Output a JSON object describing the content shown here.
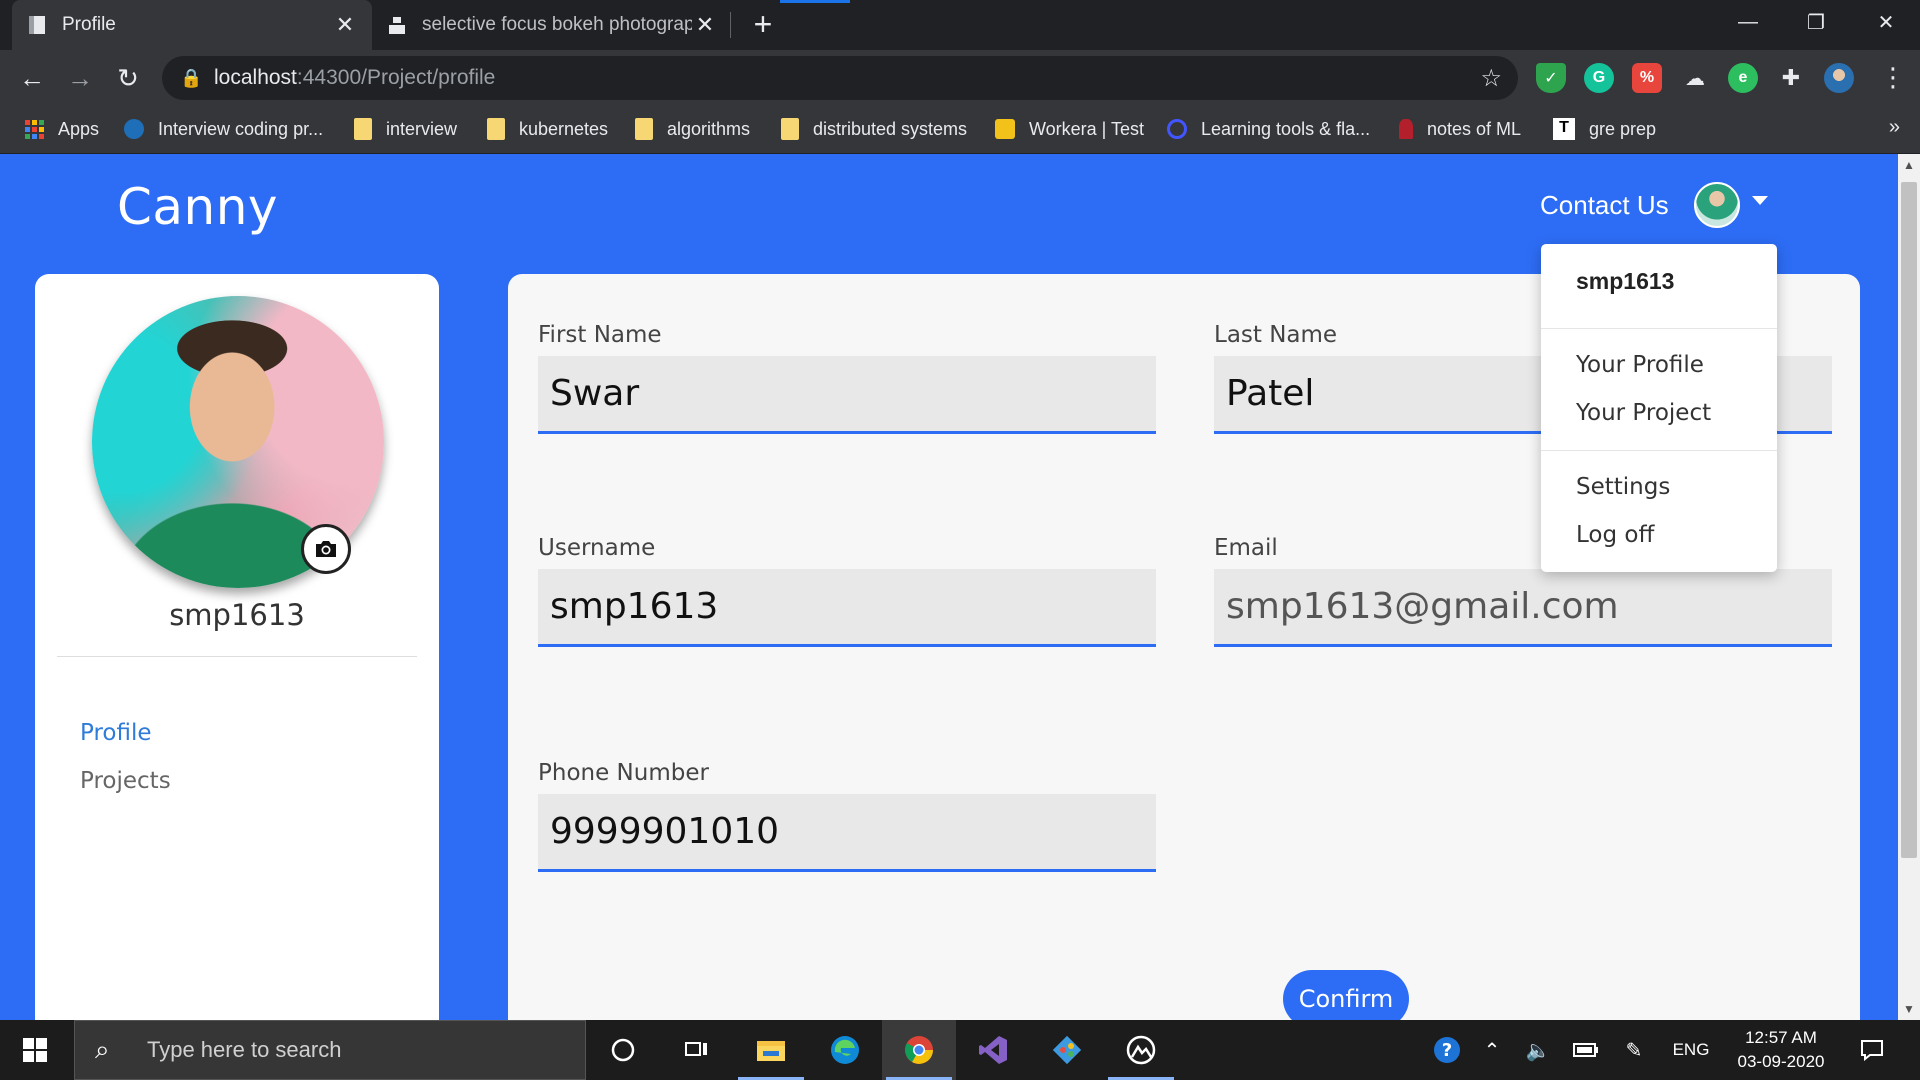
{
  "browser": {
    "tabs": [
      {
        "title": "Profile",
        "active": true
      },
      {
        "title": "selective focus bokeh photograp",
        "active": false
      }
    ],
    "url_host": "localhost",
    "url_rest": ":44300/Project/profile",
    "bookmarks": [
      {
        "label": "Apps",
        "icon": "apps-grid-icon"
      },
      {
        "label": "Interview coding pr...",
        "icon": "interview-site-icon"
      },
      {
        "label": "interview",
        "icon": "folder-icon"
      },
      {
        "label": "kubernetes",
        "icon": "folder-icon"
      },
      {
        "label": "algorithms",
        "icon": "folder-icon"
      },
      {
        "label": "distributed systems",
        "icon": "folder-icon"
      },
      {
        "label": "Workera | Test",
        "icon": "workera-icon"
      },
      {
        "label": "Learning tools & fla...",
        "icon": "quizlet-icon"
      },
      {
        "label": "notes of ML",
        "icon": "notes-icon"
      },
      {
        "label": "gre prep",
        "icon": "notion-icon"
      }
    ]
  },
  "app": {
    "brand": "Canny",
    "contact": "Contact Us"
  },
  "sidebar": {
    "username": "smp1613",
    "nav": [
      {
        "label": "Profile",
        "active": true
      },
      {
        "label": "Projects",
        "active": false
      }
    ]
  },
  "form": {
    "first_name_label": "First Name",
    "first_name": "Swar",
    "last_name_label": "Last Name",
    "last_name": "Patel",
    "username_label": "Username",
    "username": "smp1613",
    "email_label": "Email",
    "email": "smp1613@gmail.com",
    "phone_label": "Phone Number",
    "phone": "9999901010",
    "confirm_label": "Confirm"
  },
  "dropdown": {
    "username": "smp1613",
    "items": [
      "Your Profile",
      "Your Project",
      "Settings",
      "Log off"
    ]
  },
  "taskbar": {
    "search_placeholder": "Type here to search",
    "language": "ENG",
    "time": "12:57 AM",
    "date": "03-09-2020"
  },
  "colors": {
    "accent": "#2d6df5",
    "chrome_dark": "#202124",
    "chrome_toolbar": "#35363a"
  }
}
